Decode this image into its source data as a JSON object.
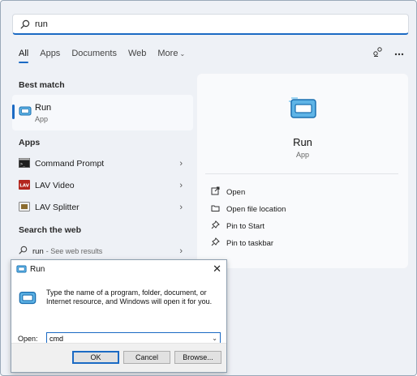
{
  "search": {
    "value": "run"
  },
  "tabs": [
    {
      "label": "All",
      "active": true
    },
    {
      "label": "Apps"
    },
    {
      "label": "Documents"
    },
    {
      "label": "Web"
    },
    {
      "label": "More"
    }
  ],
  "top_icons": [
    "share-icon",
    "more-options-icon"
  ],
  "best_match": {
    "heading": "Best match",
    "title": "Run",
    "subtitle": "App"
  },
  "apps": {
    "heading": "Apps",
    "items": [
      {
        "label": "Command Prompt",
        "icon": "command-prompt-icon"
      },
      {
        "label": "LAV Video",
        "icon": "lav-icon"
      },
      {
        "label": "LAV Splitter",
        "icon": "lav-splitter-icon"
      }
    ]
  },
  "web": {
    "heading": "Search the web",
    "query": "run",
    "hint": "- See web results"
  },
  "preview": {
    "title": "Run",
    "subtitle": "App",
    "actions": [
      {
        "label": "Open",
        "icon": "open-icon"
      },
      {
        "label": "Open file location",
        "icon": "folder-icon"
      },
      {
        "label": "Pin to Start",
        "icon": "pin-icon"
      },
      {
        "label": "Pin to taskbar",
        "icon": "pin-icon"
      }
    ]
  },
  "run_dialog": {
    "title": "Run",
    "close": "✕",
    "description": "Type the name of a program, folder, document, or Internet resource, and Windows will open it for you.",
    "open_label": "Open:",
    "open_value": "cmd",
    "buttons": {
      "ok": "OK",
      "cancel": "Cancel",
      "browse": "Browse..."
    }
  },
  "colors": {
    "accent": "#1b6ac4",
    "panel_bg": "#eef1f6"
  }
}
